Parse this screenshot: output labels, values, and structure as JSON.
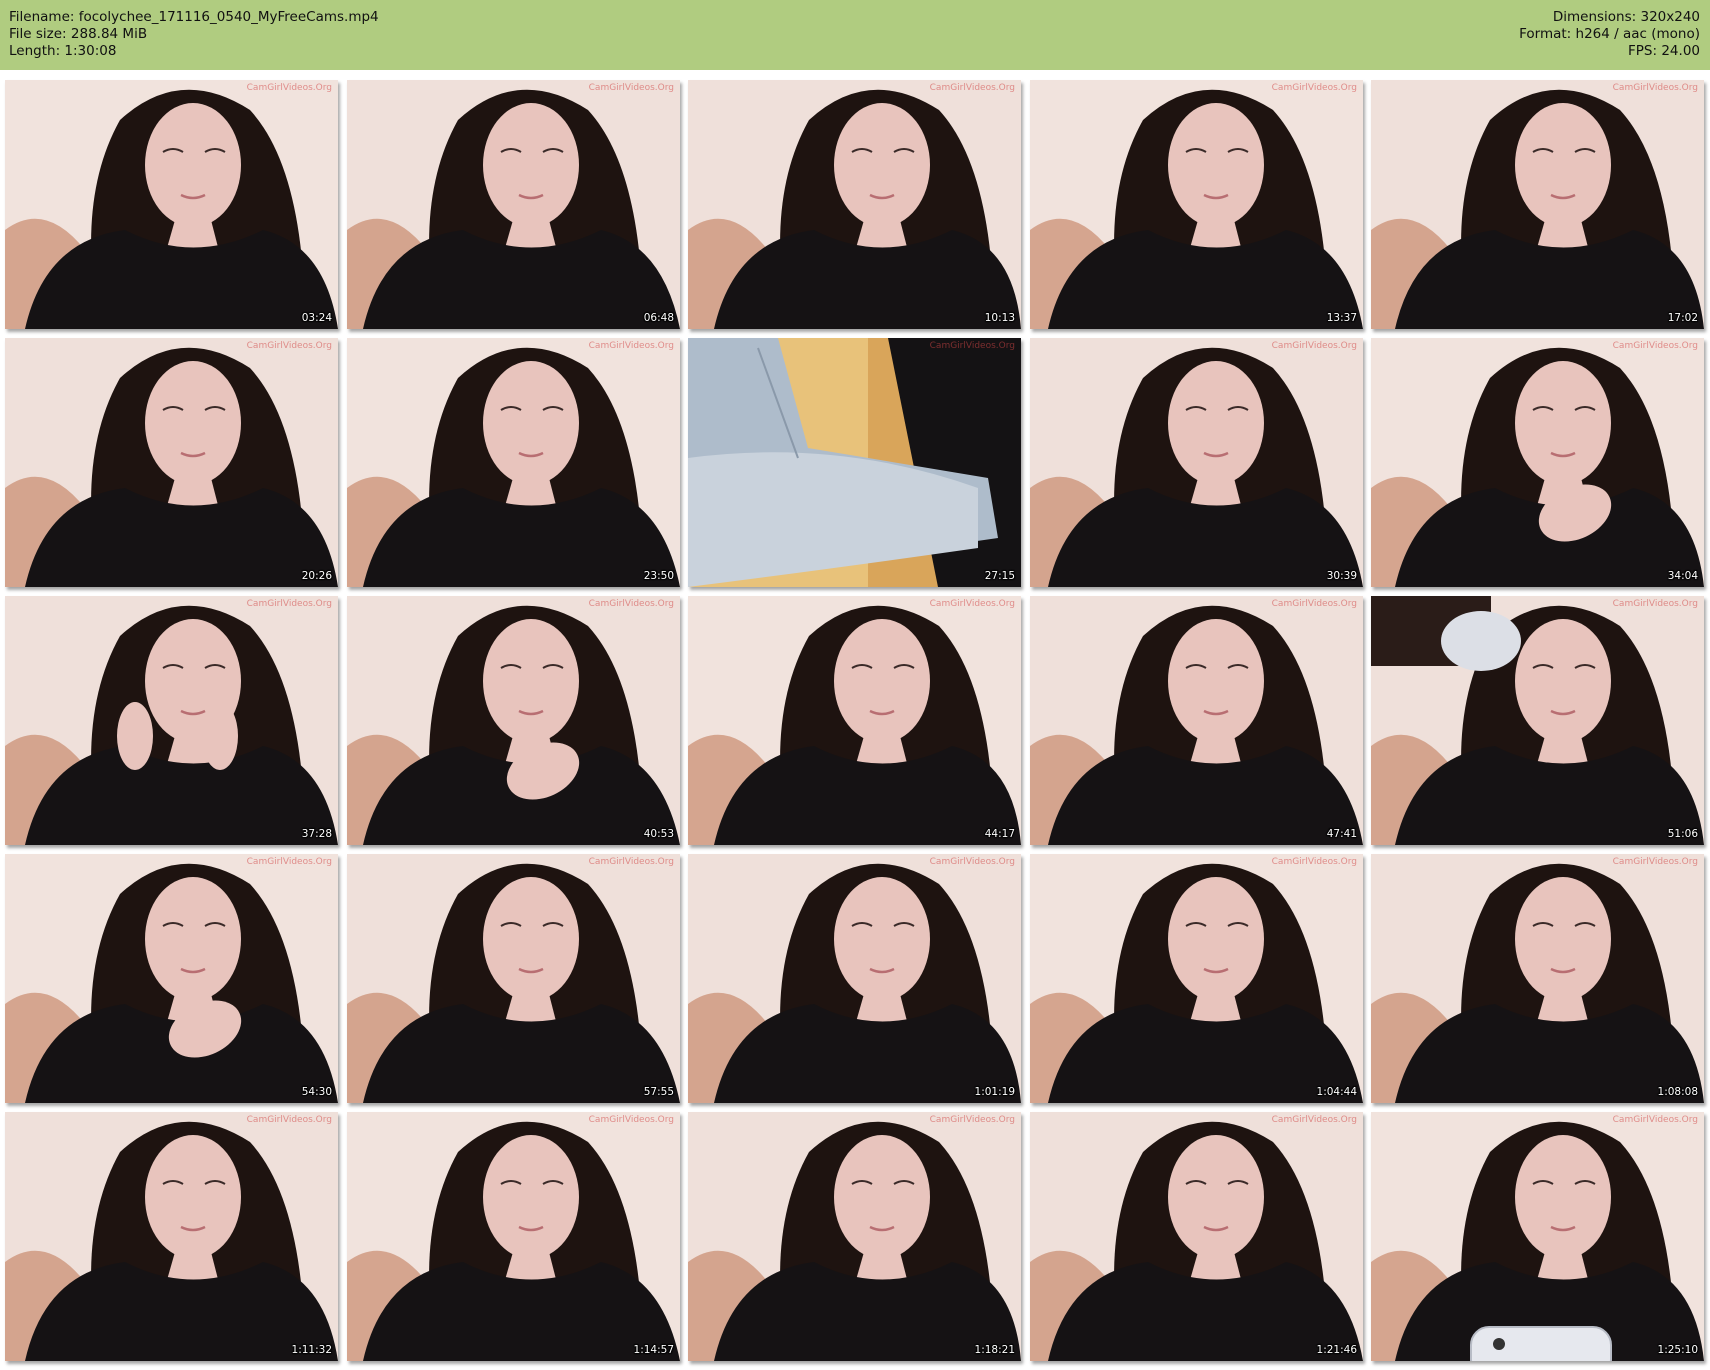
{
  "header": {
    "filename": "Filename: focolychee_171116_0540_MyFreeCams.mp4",
    "file_size": "File size: 288.84 MiB",
    "length": "Length: 1:30:08",
    "dimensions": "Dimensions: 320x240",
    "format": "Format: h264 / aac (mono)",
    "fps": "FPS: 24.00",
    "background_color": "#b0cc80"
  },
  "watermark": "CamGirlVideos.Org",
  "thumbnails": [
    {
      "timestamp": "03:24",
      "scene": "portrait"
    },
    {
      "timestamp": "06:48",
      "scene": "portrait"
    },
    {
      "timestamp": "10:13",
      "scene": "portrait"
    },
    {
      "timestamp": "13:37",
      "scene": "portrait"
    },
    {
      "timestamp": "17:02",
      "scene": "portrait"
    },
    {
      "timestamp": "20:26",
      "scene": "portrait"
    },
    {
      "timestamp": "23:50",
      "scene": "portrait"
    },
    {
      "timestamp": "27:15",
      "scene": "legs"
    },
    {
      "timestamp": "30:39",
      "scene": "portrait"
    },
    {
      "timestamp": "34:04",
      "scene": "portrait-hand"
    },
    {
      "timestamp": "37:28",
      "scene": "portrait-hands"
    },
    {
      "timestamp": "40:53",
      "scene": "portrait-hand"
    },
    {
      "timestamp": "44:17",
      "scene": "portrait"
    },
    {
      "timestamp": "47:41",
      "scene": "portrait"
    },
    {
      "timestamp": "51:06",
      "scene": "portrait-arm"
    },
    {
      "timestamp": "54:30",
      "scene": "portrait-hand"
    },
    {
      "timestamp": "57:55",
      "scene": "portrait"
    },
    {
      "timestamp": "1:01:19",
      "scene": "portrait"
    },
    {
      "timestamp": "1:04:44",
      "scene": "portrait"
    },
    {
      "timestamp": "1:08:08",
      "scene": "portrait"
    },
    {
      "timestamp": "1:11:32",
      "scene": "portrait"
    },
    {
      "timestamp": "1:14:57",
      "scene": "portrait"
    },
    {
      "timestamp": "1:18:21",
      "scene": "portrait"
    },
    {
      "timestamp": "1:21:46",
      "scene": "portrait"
    },
    {
      "timestamp": "1:25:10",
      "scene": "portrait-phone"
    }
  ]
}
